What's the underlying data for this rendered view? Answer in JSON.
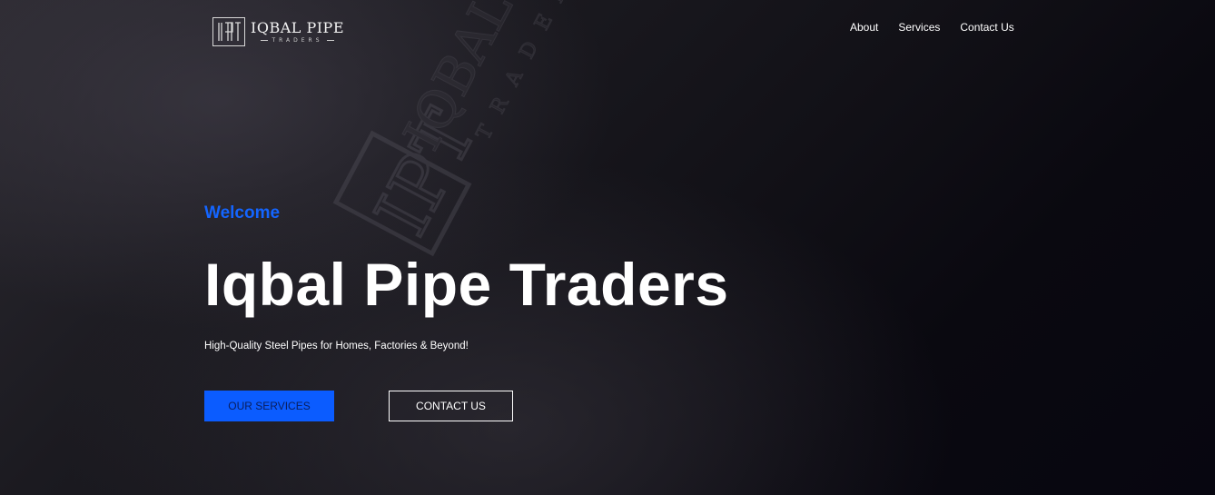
{
  "brand": {
    "name": "IQBAL PIPE",
    "subtitle": "TRADERS",
    "icon": "ipt-monogram-logo"
  },
  "nav": {
    "items": [
      {
        "label": "About"
      },
      {
        "label": "Services"
      },
      {
        "label": "Contact Us"
      }
    ]
  },
  "hero": {
    "eyebrow": "Welcome",
    "title": "Iqbal Pipe Traders",
    "tagline": "High-Quality Steel Pipes for Homes, Factories & Beyond!",
    "primary_button": "OUR SERVICES",
    "secondary_button": "CONTACT US",
    "background_text": "IQBAL PIPE",
    "background_subtext": "TRADERS"
  },
  "colors": {
    "accent": "#1465ff",
    "button_primary": "#0b5cff",
    "background": "#0b0a10",
    "text": "#ffffff"
  }
}
